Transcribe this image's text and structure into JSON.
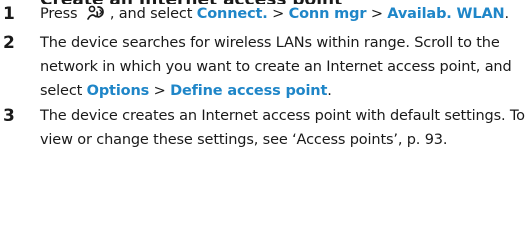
{
  "steps": [
    {
      "number": "1",
      "text_before_icon": "Press",
      "icon": "menu-key-icon",
      "text_after_icon": ", and select",
      "path": [
        "Connect.",
        "Conn mgr",
        "Availab. WLAN"
      ],
      "separator": ">",
      "end": "."
    },
    {
      "number": "2",
      "text": "The device searches for wireless LANs within range. Scroll to the network in which you want to create an Internet access point, and select",
      "path": [
        "Options",
        "Define access point"
      ],
      "separator": ">",
      "end": "."
    },
    {
      "number": "3",
      "text": "The device creates an Internet access point with default settings. To view or change these settings, see ‘Access points’, p. 93."
    }
  ],
  "colors": {
    "ui_term": "#1f86c8",
    "text": "#1a1a1a"
  }
}
